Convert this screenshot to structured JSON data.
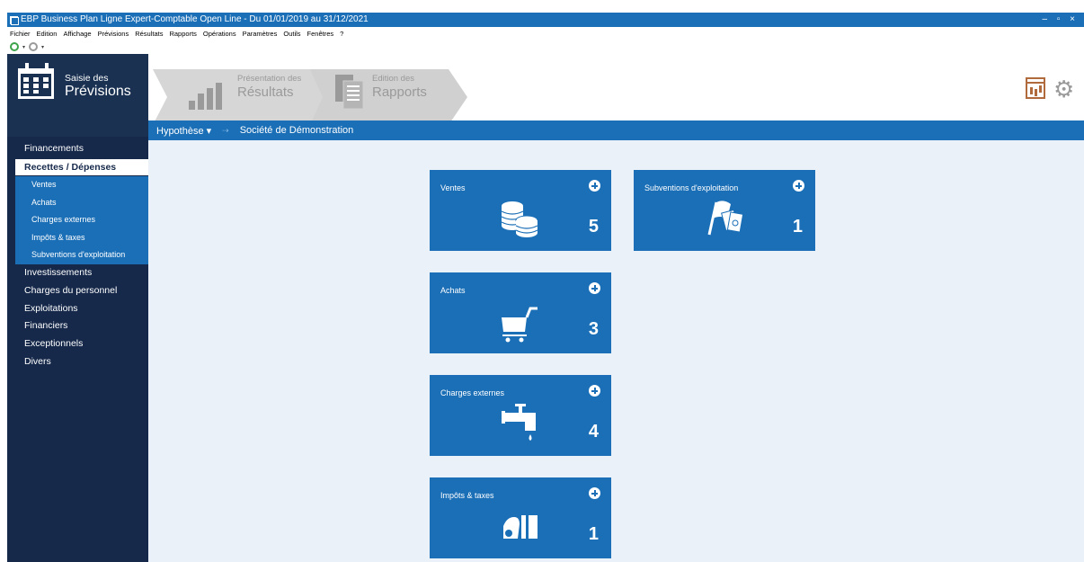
{
  "window": {
    "title": "EBP Business Plan Ligne Expert-Comptable Open Line - Du 01/01/2019 au 31/12/2021",
    "controls": "– ▫ ×"
  },
  "menu": [
    "Fichier",
    "Edition",
    "Affichage",
    "Prévisions",
    "Résultats",
    "Rapports",
    "Opérations",
    "Paramètres",
    "Outils",
    "Fenêtres",
    "?"
  ],
  "steps": {
    "saisie_small": "Saisie des",
    "saisie_big": "Prévisions",
    "presentation_small": "Présentation des",
    "presentation_big": "Résultats",
    "edition_small": "Edition des",
    "edition_big": "Rapports"
  },
  "breadcrumb": {
    "hypothese": "Hypothèse ▾",
    "separator": "⇢",
    "societe": "Société de Démonstration"
  },
  "nav": {
    "items": [
      "Financements",
      "Recettes / Dépenses",
      "Investissements",
      "Charges du personnel",
      "Exploitations",
      "Financiers",
      "Exceptionnels",
      "Divers"
    ],
    "subitems": [
      "Ventes",
      "Achats",
      "Charges externes",
      "Impôts & taxes",
      "Subventions d'exploitation"
    ]
  },
  "tiles": [
    {
      "label": "Ventes",
      "count": "5",
      "icon": "coins-icon"
    },
    {
      "label": "Achats",
      "count": "3",
      "icon": "cart-icon"
    },
    {
      "label": "Charges externes",
      "count": "4",
      "icon": "faucet-icon"
    },
    {
      "label": "Impôts & taxes",
      "count": "1",
      "icon": "taxes-icon"
    },
    {
      "label": "Subventions d'exploitation",
      "count": "1",
      "icon": "flag-money-icon"
    }
  ],
  "colors": {
    "brand_blue": "#1b6fb7",
    "nav_dark": "#16294b",
    "content_bg": "#eaf1f8"
  }
}
